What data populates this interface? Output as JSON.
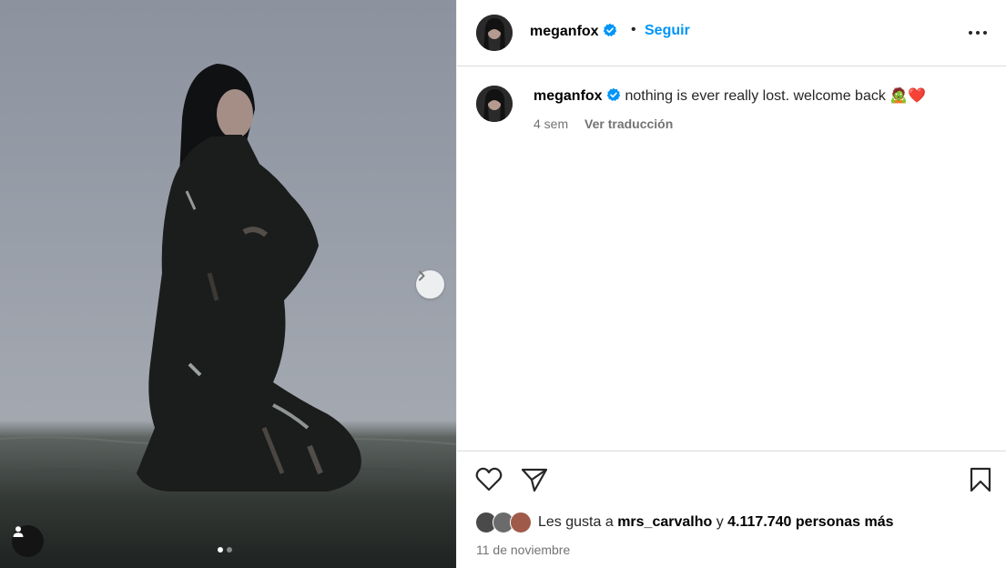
{
  "post": {
    "username": "meganfox",
    "follow_label": "Seguir",
    "separator": "•",
    "caption": "nothing is ever really lost. welcome back 🧟❤️",
    "time_ago": "4 sem",
    "translate_label": "Ver traducción",
    "likes_prefix": "Les gusta a",
    "likes_user": "mrs_carvalho",
    "likes_conj": "y",
    "likes_count": "4.117.740 personas más",
    "date": "11 de noviembre"
  },
  "carousel": {
    "total": 2,
    "current": 1
  },
  "icons": {
    "verified": "verified-badge-icon",
    "more": "more-options-icon",
    "like": "heart-icon",
    "share": "send-icon",
    "save": "bookmark-icon",
    "next": "chevron-right-icon",
    "tagged": "user-tag-icon"
  },
  "colors": {
    "accent": "#0095f6",
    "secondary_text": "#737373",
    "border": "#dbdbdb"
  }
}
